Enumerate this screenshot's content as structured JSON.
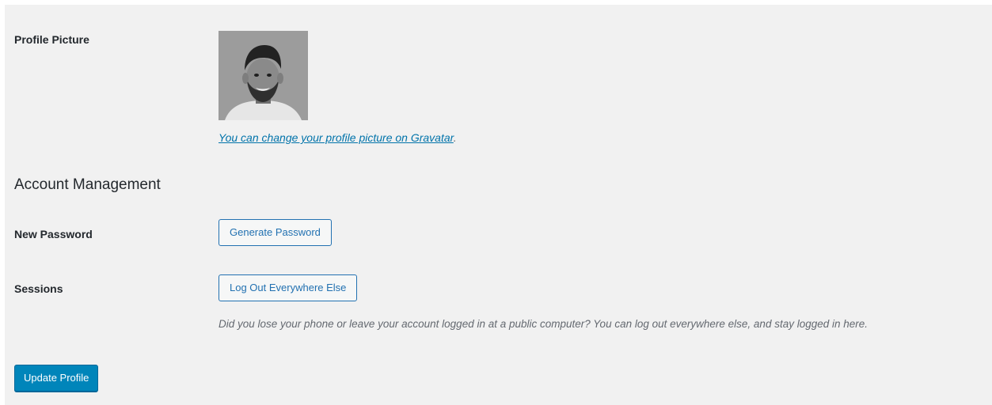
{
  "profile_picture": {
    "label": "Profile Picture",
    "gravatar_link_text": "You can change your profile picture on Gravatar",
    "gravatar_suffix": "."
  },
  "account_management": {
    "heading": "Account Management",
    "new_password": {
      "label": "New Password",
      "button_label": "Generate Password"
    },
    "sessions": {
      "label": "Sessions",
      "button_label": "Log Out Everywhere Else",
      "description": "Did you lose your phone or leave your account logged in at a public computer? You can log out everywhere else, and stay logged in here."
    }
  },
  "submit": {
    "button_label": "Update Profile"
  },
  "colors": {
    "panel_background": "#f1f1f1",
    "link": "#0073aa",
    "primary_button": "#0085ba",
    "secondary_button_border": "#2271b1"
  }
}
